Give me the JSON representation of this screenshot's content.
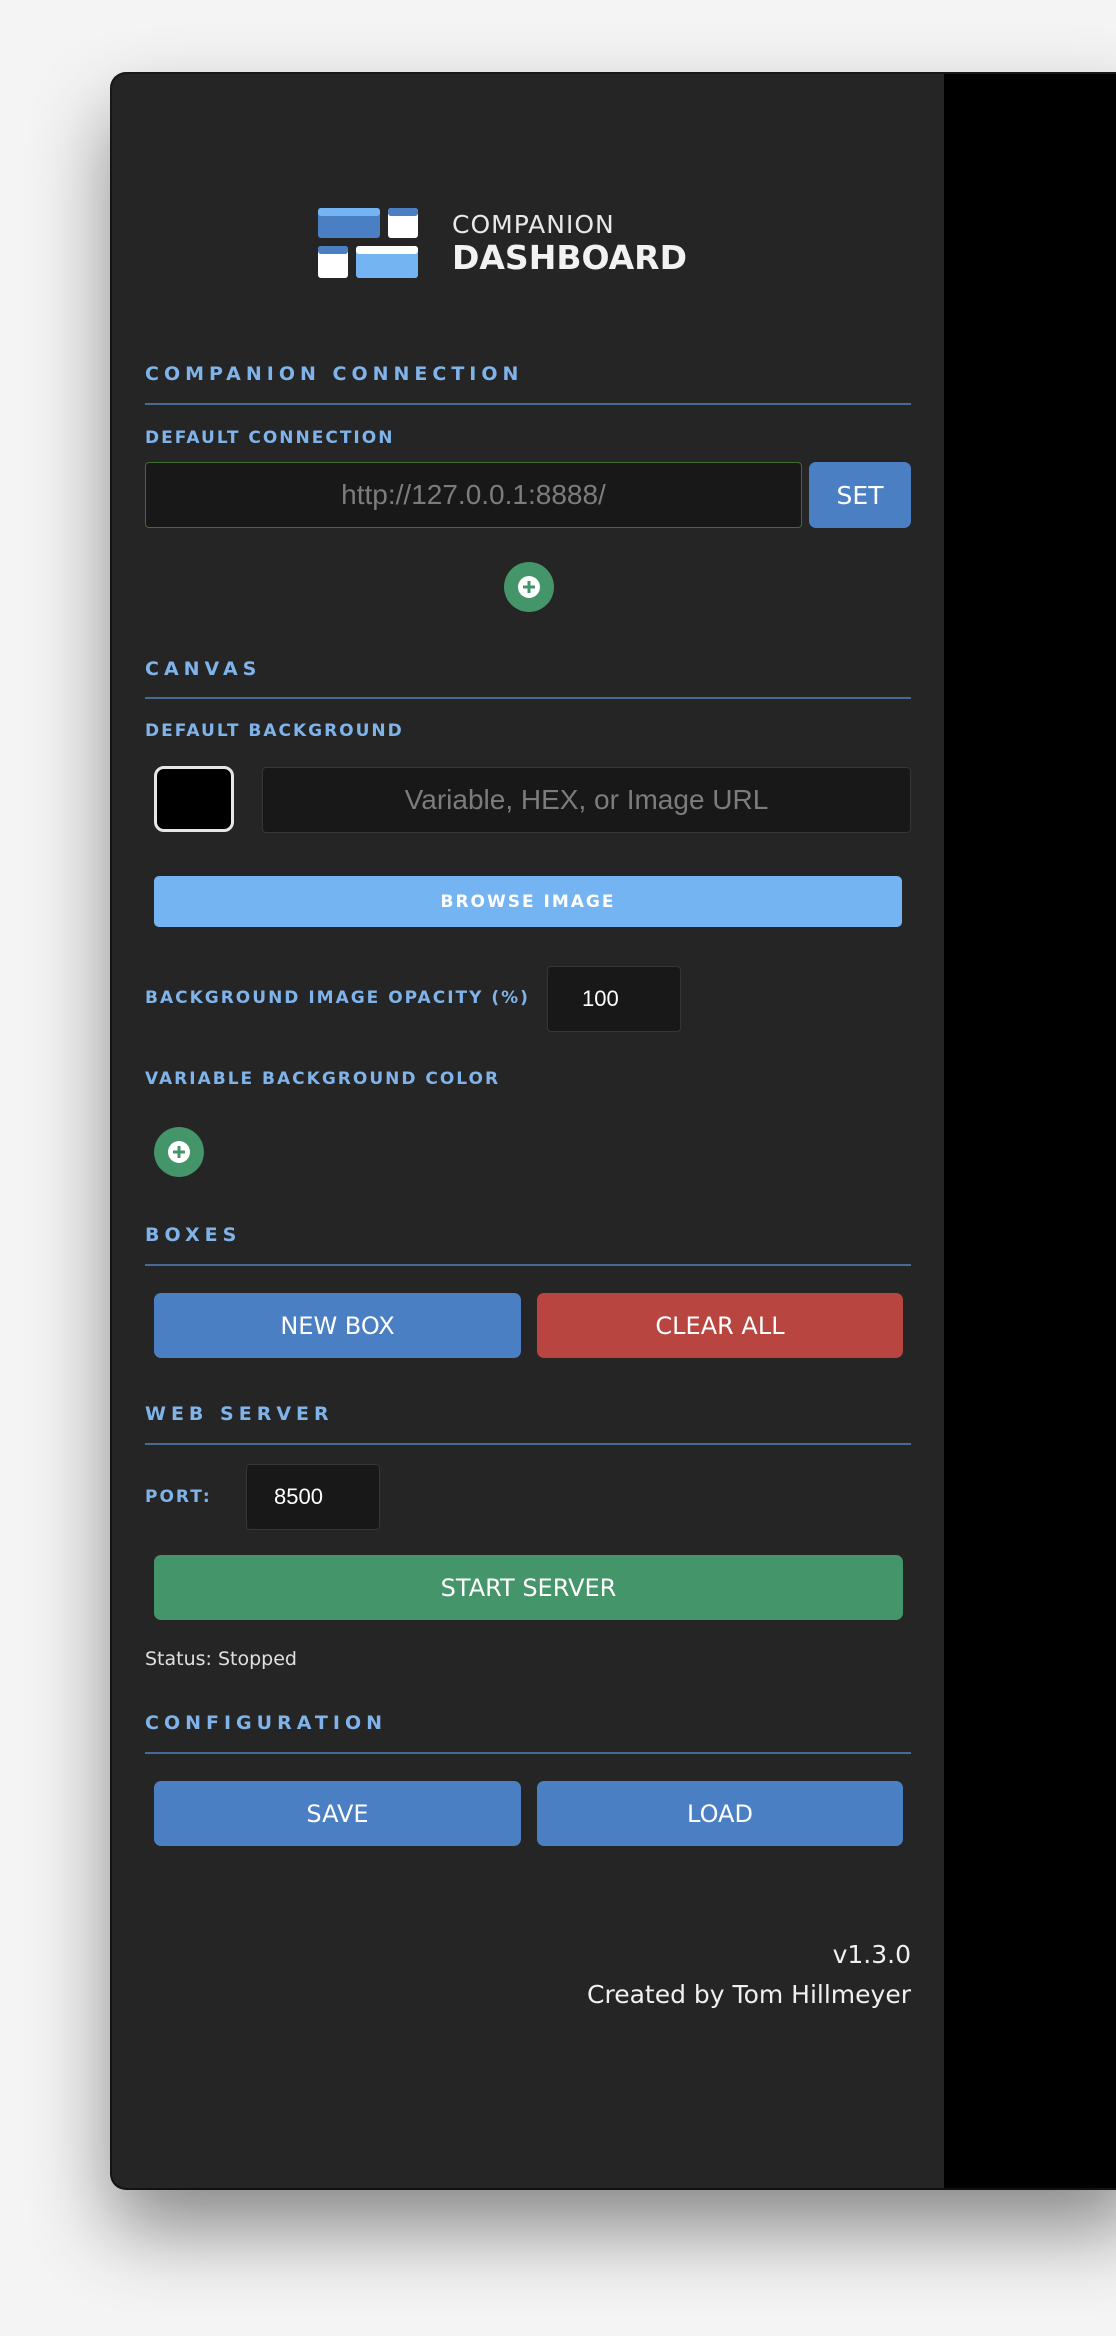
{
  "app": {
    "logo_line1": "COMPANION",
    "logo_line2": "DASHBOARD"
  },
  "companion_connection": {
    "title": "COMPANION CONNECTION",
    "default_connection_label": "DEFAULT CONNECTION",
    "url_value": "",
    "url_placeholder": "http://127.0.0.1:8888/",
    "set_label": "SET",
    "add_icon": "plus-circle-icon"
  },
  "canvas": {
    "title": "CANVAS",
    "default_background_label": "DEFAULT BACKGROUND",
    "swatch_color": "#000000",
    "background_value": "",
    "background_placeholder": "Variable, HEX, or Image URL",
    "browse_label": "BROWSE IMAGE",
    "opacity_label": "BACKGROUND IMAGE OPACITY (%)",
    "opacity_value": "100",
    "variable_bg_label": "VARIABLE BACKGROUND COLOR",
    "add_icon": "plus-circle-icon"
  },
  "boxes": {
    "title": "BOXES",
    "new_box_label": "NEW BOX",
    "clear_all_label": "CLEAR ALL"
  },
  "web_server": {
    "title": "WEB SERVER",
    "port_label": "PORT:",
    "port_value": "8500",
    "start_label": "START SERVER",
    "status": "Status: Stopped"
  },
  "configuration": {
    "title": "CONFIGURATION",
    "save_label": "SAVE",
    "load_label": "LOAD"
  },
  "footer": {
    "version": "v1.3.0",
    "credit": "Created by Tom Hillmeyer"
  },
  "colors": {
    "accent_blue": "#4b7fc4",
    "light_blue": "#74b4f3",
    "danger_red": "#b94540",
    "success_green": "#449569",
    "sidebar_bg": "#252525"
  }
}
